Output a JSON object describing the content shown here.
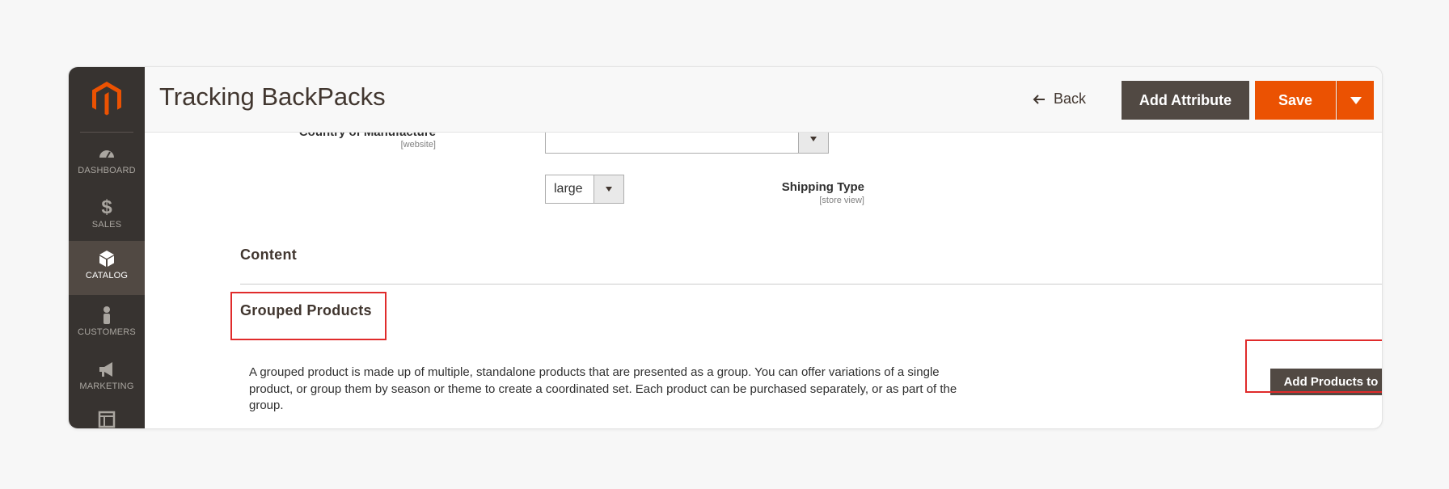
{
  "header": {
    "title": "Tracking BackPacks",
    "back_label": "Back",
    "add_attribute_label": "Add Attribute",
    "save_label": "Save"
  },
  "sidebar": {
    "items": [
      {
        "label": "DASHBOARD",
        "icon": "dashboard-icon"
      },
      {
        "label": "SALES",
        "icon": "dollar-icon"
      },
      {
        "label": "CATALOG",
        "icon": "cube-icon",
        "active": true
      },
      {
        "label": "CUSTOMERS",
        "icon": "person-icon"
      },
      {
        "label": "MARKETING",
        "icon": "megaphone-icon"
      },
      {
        "label": "",
        "icon": "content-icon"
      }
    ]
  },
  "fields": {
    "country": {
      "label": "Country of Manufacture",
      "scope": "[website]",
      "value": ""
    },
    "shipping": {
      "label": "Shipping Type",
      "scope": "[store view]",
      "value": "large"
    }
  },
  "sections": {
    "content_title": "Content",
    "grouped_title": "Grouped Products",
    "grouped_description": "A grouped product is made up of multiple, standalone products that are presented as a group. You can offer variations of a single product, or group them by season or theme to create a coordinated set. Each product can be purchased separately, or as part of the group.",
    "add_products_label": "Add Products to Group"
  },
  "colors": {
    "accent": "#eb5202",
    "sidebar": "#373330",
    "dark_button": "#514943",
    "highlight": "#e02b2b"
  }
}
